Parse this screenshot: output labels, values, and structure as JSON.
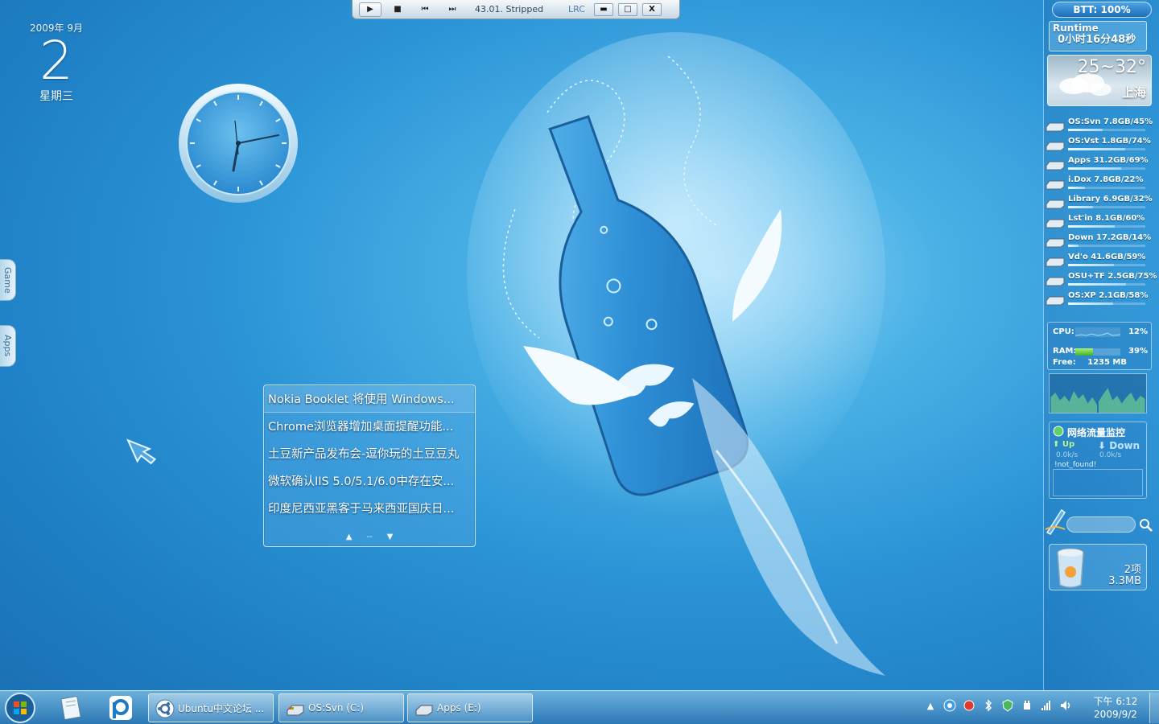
{
  "media_player": {
    "track": "43.01. Stripped",
    "lrc_label": "LRC",
    "play_icon": "▶",
    "stop_icon": "■",
    "prev_icon": "⏮",
    "next_icon": "⏭",
    "minimize_icon": "▬",
    "maximize_icon": "□",
    "close_icon": "X"
  },
  "date_widget": {
    "year_month": "2009年 9月",
    "day": "2",
    "weekday": "星期三"
  },
  "side_dock": {
    "tabs": [
      "Game",
      "Apps"
    ]
  },
  "news": {
    "items": [
      "Nokia Booklet 将使用 Windows...",
      "Chrome浏览器增加桌面提醒功能...",
      "土豆新产品发布会-逗你玩的土豆豆丸",
      "微软确认IIS 5.0/5.1/6.0中存在安...",
      "印度尼西亚黑客于马来西亚国庆日..."
    ],
    "nav_up": "▲",
    "nav_mid": "--",
    "nav_down": "▼"
  },
  "sidebar": {
    "battery": "BTT: 100%",
    "runtime_label": "Runtime",
    "runtime_value": "0小时16分48秒",
    "weather": {
      "temp": "25~32°",
      "city": "上海"
    },
    "drives": [
      {
        "label": "OS:Svn 7.8GB/45%",
        "used": 0.45
      },
      {
        "label": "OS:Vst 1.8GB/74%",
        "used": 0.74
      },
      {
        "label": "Apps 31.2GB/69%",
        "used": 0.69
      },
      {
        "label": "i.Dox 7.8GB/22%",
        "used": 0.22
      },
      {
        "label": "Library 6.9GB/32%",
        "used": 0.32
      },
      {
        "label": "Lst'in 8.1GB/60%",
        "used": 0.6
      },
      {
        "label": "Down 17.2GB/14%",
        "used": 0.14
      },
      {
        "label": "Vd'o 41.6GB/59%",
        "used": 0.59
      },
      {
        "label": "OSU+TF 2.5GB/75%",
        "used": 0.75
      },
      {
        "label": "OS:XP 2.1GB/58%",
        "used": 0.58
      }
    ],
    "monitor": {
      "cpu_label": "CPU:",
      "cpu_value": "12%",
      "ram_label": "RAM:",
      "ram_value": "39%",
      "free_label": "Free:",
      "free_value": "1235 MB"
    },
    "network": {
      "title": "网络流量监控",
      "up_label": "Up",
      "down_label": "Down",
      "up_value": "0.0k/s",
      "down_value": "0.0k/s",
      "status": "!not_found!"
    },
    "recycle_bin": {
      "count": "2项",
      "size": "3.3MB"
    }
  },
  "taskbar": {
    "tasks": [
      {
        "label": "Ubuntu中文论坛 ..."
      },
      {
        "label": "OS:Svn (C:)"
      },
      {
        "label": "Apps (E:)"
      }
    ],
    "tray_expand": "▲",
    "clock_time": "下午 6:12",
    "clock_date": "2009/9/2"
  }
}
